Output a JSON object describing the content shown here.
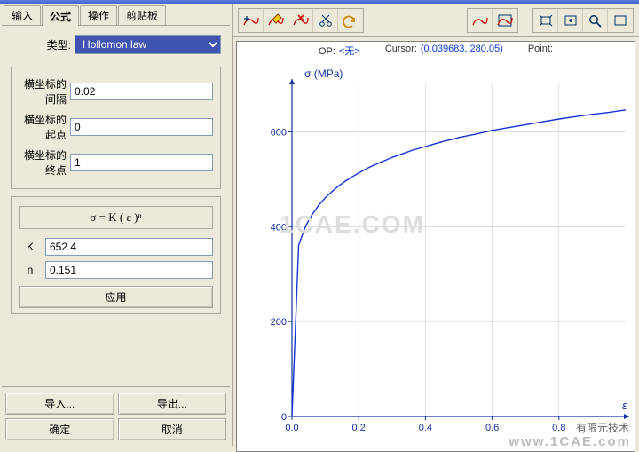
{
  "tabs": {
    "t0": "输入",
    "t1": "公式",
    "t2": "操作",
    "t3": "剪贴板"
  },
  "type_label": "类型:",
  "type_value": "Hollomon law",
  "interval_label": "横坐标的间隔",
  "interval_value": "0.02",
  "start_label": "横坐标的起点",
  "start_value": "0",
  "end_label": "横坐标的终点",
  "end_value": "1",
  "formula": "σ = K ( ε )ⁿ",
  "k_label": "K",
  "k_value": "652.4",
  "n_label": "n",
  "n_value": "0.151",
  "apply_label": "应用",
  "import_label": "导入...",
  "export_label": "导出...",
  "ok_label": "确定",
  "cancel_label": "取消",
  "op_label": "OP:",
  "op_value": "<无>",
  "cursor_label": "Cursor:",
  "cursor_value": "(0.039683, 280.05)",
  "point_label": "Point:",
  "y_axis_label": "σ (MPa)",
  "x_axis_label": "ε",
  "watermark1": "1CAE.COM",
  "watermark2": "www.1CAE.com",
  "footer_credit": "有限元技术",
  "chart_data": {
    "type": "line",
    "xlabel": "ε",
    "ylabel": "σ (MPa)",
    "x_range": [
      0,
      1
    ],
    "y_range": [
      0,
      700
    ],
    "x_ticks": [
      0.0,
      0.2,
      0.4,
      0.6,
      0.8
    ],
    "y_ticks": [
      0,
      200,
      400,
      600
    ],
    "x": [
      0.0,
      0.02,
      0.04,
      0.06,
      0.08,
      0.1,
      0.12,
      0.14,
      0.16,
      0.18,
      0.2,
      0.22,
      0.24,
      0.26,
      0.28,
      0.3,
      0.32,
      0.34,
      0.36,
      0.38,
      0.4,
      0.42,
      0.44,
      0.46,
      0.48,
      0.5,
      0.55,
      0.6,
      0.65,
      0.7,
      0.75,
      0.8,
      0.85,
      0.9,
      0.95,
      1.0
    ],
    "y": [
      0,
      361,
      400,
      425,
      445,
      461,
      474,
      486,
      496,
      505,
      513,
      521,
      528,
      534,
      540,
      546,
      551,
      556,
      561,
      565,
      569,
      573,
      577,
      581,
      584,
      588,
      595,
      603,
      609,
      615,
      621,
      627,
      632,
      637,
      641,
      646
    ]
  }
}
